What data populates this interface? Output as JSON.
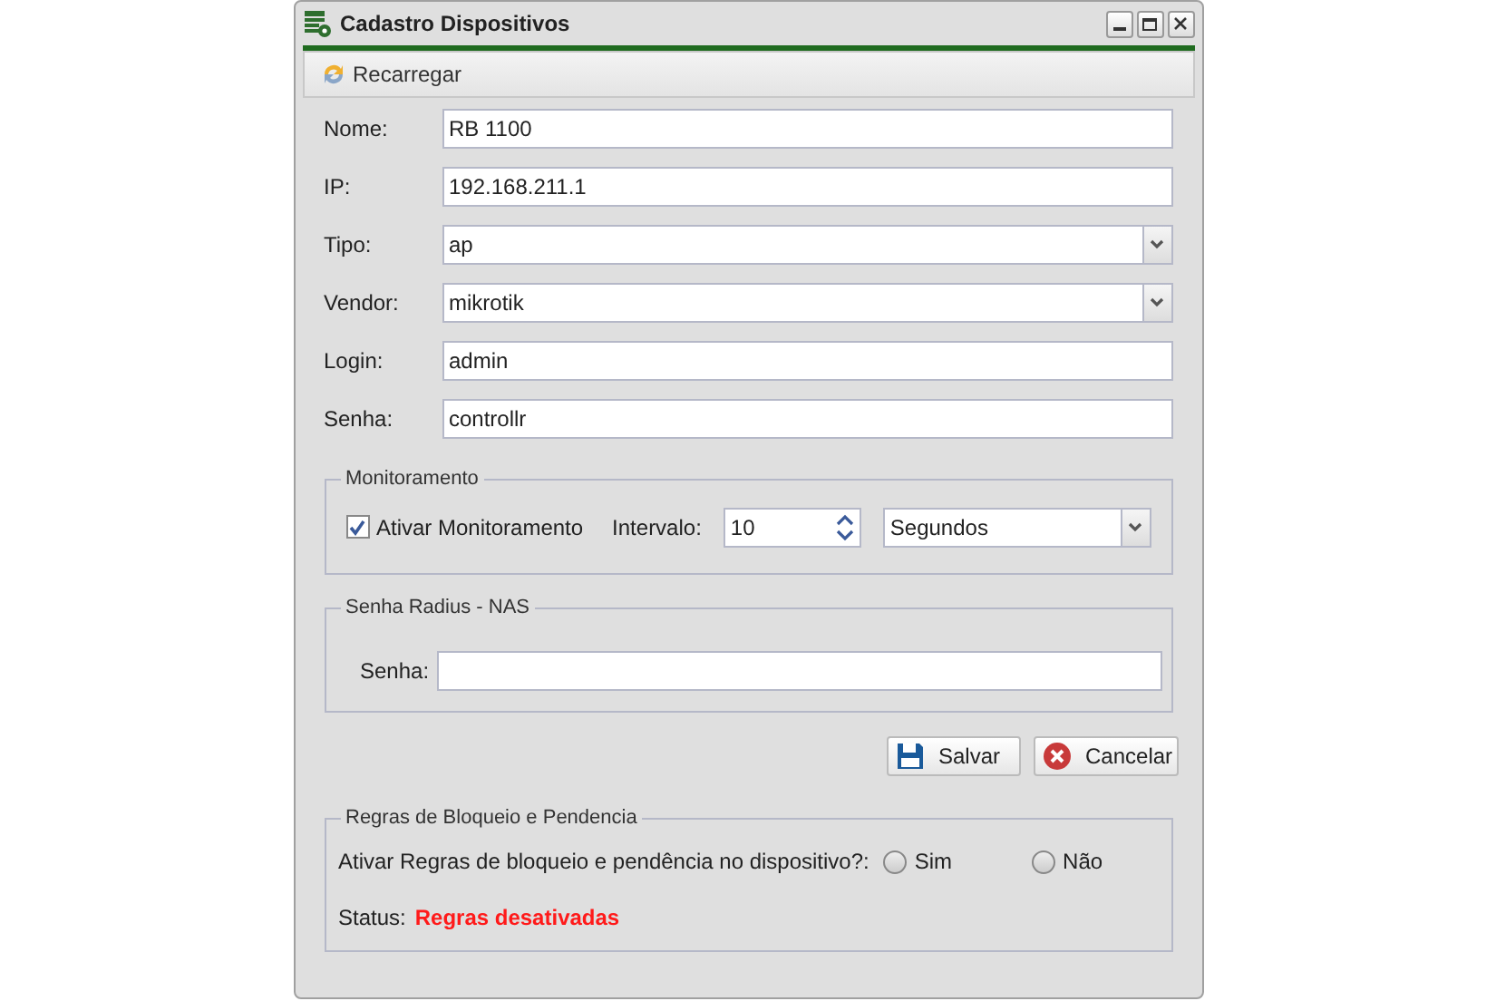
{
  "window": {
    "title": "Cadastro Dispositivos"
  },
  "toolbar": {
    "reload_button": "Recarregar"
  },
  "fields": [
    {
      "label": "Nome:",
      "value": "RB 1100",
      "kind": "text"
    },
    {
      "label": "IP:",
      "value": "192.168.211.1",
      "kind": "text"
    },
    {
      "label": "Tipo:",
      "value": "ap",
      "kind": "select"
    },
    {
      "label": "Vendor:",
      "value": "mikrotik",
      "kind": "select"
    },
    {
      "label": "Login:",
      "value": "admin",
      "kind": "text"
    },
    {
      "label": "Senha:",
      "value": "controllr",
      "kind": "text"
    }
  ],
  "monitoring": {
    "legend": "Monitoramento",
    "checkbox_label": "Ativar Monitoramento",
    "checked": true,
    "interval_label": "Intervalo:",
    "interval_value": "10",
    "unit": "Segundos"
  },
  "radius": {
    "legend": "Senha Radius - NAS",
    "label": "Senha:"
  },
  "buttons": [
    {
      "label": "Salvar",
      "kind": "save"
    },
    {
      "label": "Cancelar",
      "kind": "cancel"
    }
  ],
  "rules": {
    "legend": "Regras de Bloqueio e Pendencia",
    "question": "Ativar Regras de bloqueio e pendência no dispositivo?:",
    "options": [
      {
        "label": "Sim",
        "selected": false
      },
      {
        "label": "Não",
        "selected": false
      }
    ],
    "status_label": "Status:",
    "status_value": "Regras desativadas"
  }
}
